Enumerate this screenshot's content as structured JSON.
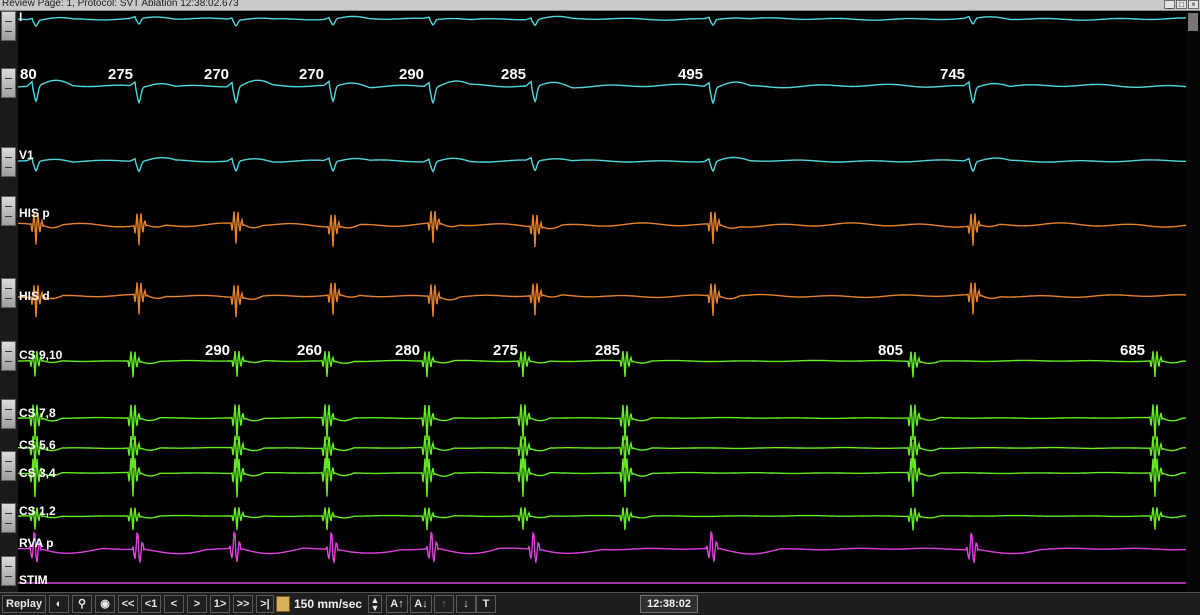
{
  "window": {
    "title": "Review Page: 1, Protocol: SVT Ablation   12:38:02.673",
    "buttons": [
      "minimize-icon",
      "restore-icon",
      "close-icon"
    ]
  },
  "channels": [
    {
      "id": "I",
      "label": "I",
      "color": "#4fd8e0"
    },
    {
      "id": "II",
      "label": "",
      "color": "#4fd8e0"
    },
    {
      "id": "V1",
      "label": "V1",
      "color": "#4fd8e0"
    },
    {
      "id": "HISp",
      "label": "HIS p",
      "color": "#e8832a"
    },
    {
      "id": "HISd",
      "label": "HIS d",
      "color": "#e8832a"
    },
    {
      "id": "CS910",
      "label": "CS 9,10",
      "color": "#66ee22"
    },
    {
      "id": "CS78",
      "label": "CS 7,8",
      "color": "#66ee22"
    },
    {
      "id": "CS56",
      "label": "CS 5,6",
      "color": "#66ee22"
    },
    {
      "id": "CS34",
      "label": "CS 3,4",
      "color": "#66ee22"
    },
    {
      "id": "CS12",
      "label": "CS 1,2",
      "color": "#66ee22"
    },
    {
      "id": "RVAp",
      "label": "RVA p",
      "color": "#e040e0"
    },
    {
      "id": "STIM",
      "label": "STIM",
      "color": "#e040e0"
    }
  ],
  "intervals": {
    "surface": [
      "80",
      "275",
      "270",
      "270",
      "290",
      "285",
      "495",
      "745"
    ],
    "cs": [
      "290",
      "260",
      "280",
      "275",
      "285",
      "805",
      "685"
    ]
  },
  "toolbar": {
    "replay": "Replay",
    "nav_first": "<<",
    "nav_prev_page": "<1",
    "nav_prev": "<",
    "nav_next": ">",
    "nav_next_page": "1>",
    "nav_last": ">>",
    "nav_end": ">|",
    "speed": "150 mm/sec",
    "gain_up": "A↑",
    "gain_down": "A↓",
    "up": "↑",
    "down": "↓",
    "text_tool": "T",
    "clock": "12:38:02"
  }
}
